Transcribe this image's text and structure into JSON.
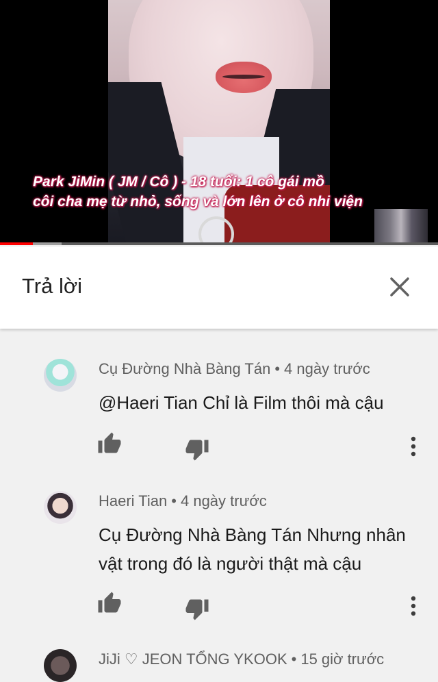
{
  "video": {
    "subtitle_line1": "Park JiMin ( JM / Cô ) - 18 tuổi: 1 cô gái mồ",
    "subtitle_line2": "côi cha mẹ từ nhỏ, sống và lớn lên ở cô nhi viện",
    "progress_played_fraction": 0.075,
    "progress_buffered_fraction": 0.14,
    "progress_color": "#ff0000"
  },
  "reply_panel": {
    "title": "Trả lời",
    "close_icon": "close-icon"
  },
  "comments": [
    {
      "author": "Cụ Đường Nhà Bàng Tán",
      "separator": "•",
      "time": "4 ngày trước",
      "text": "@Haeri Tian Chỉ là Film thôi mà cậu"
    },
    {
      "author": "Haeri Tian",
      "separator": "•",
      "time": "4 ngày trước",
      "text": "Cụ Đường Nhà Bàng Tán Nhưng nhân vật trong đó là người thật mà cậu"
    },
    {
      "author": "JiJi ♡ JEON TỔNG YKOOK",
      "separator": "•",
      "time": "15 giờ trước",
      "text": ""
    }
  ],
  "icons": {
    "like": "thumb-up-icon",
    "dislike": "thumb-down-icon",
    "menu": "more-vert-icon"
  }
}
